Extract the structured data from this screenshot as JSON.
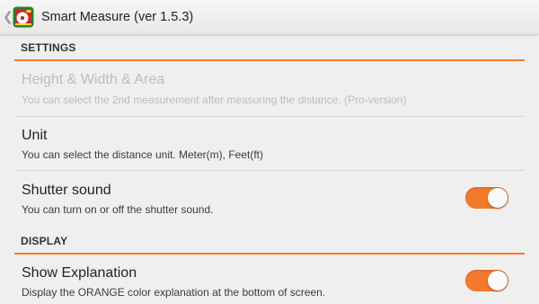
{
  "actionbar": {
    "title": "Smart Measure (ver 1.5.3)",
    "back_glyph": "❮",
    "app_icon": "tape-measure-icon"
  },
  "sections": [
    {
      "title": "SETTINGS",
      "prefs": [
        {
          "title": "Height & Width & Area",
          "summary": "You can select the 2nd measurement after measuring the distance. (Pro-version)",
          "enabled": false
        },
        {
          "title": "Unit",
          "summary": "You can select the distance unit. Meter(m), Feet(ft)",
          "enabled": true
        },
        {
          "title": "Shutter sound",
          "summary": "You can turn on or off the shutter sound.",
          "enabled": true,
          "toggle_on": true
        }
      ]
    },
    {
      "title": "DISPLAY",
      "prefs": [
        {
          "title": "Show Explanation",
          "summary": "Display the ORANGE color explanation at the bottom of screen.",
          "enabled": true,
          "toggle_on": true
        }
      ]
    }
  ],
  "colors": {
    "accent": "#f37a2b",
    "background": "#efefef",
    "disabled_text": "#bcbcbc"
  }
}
